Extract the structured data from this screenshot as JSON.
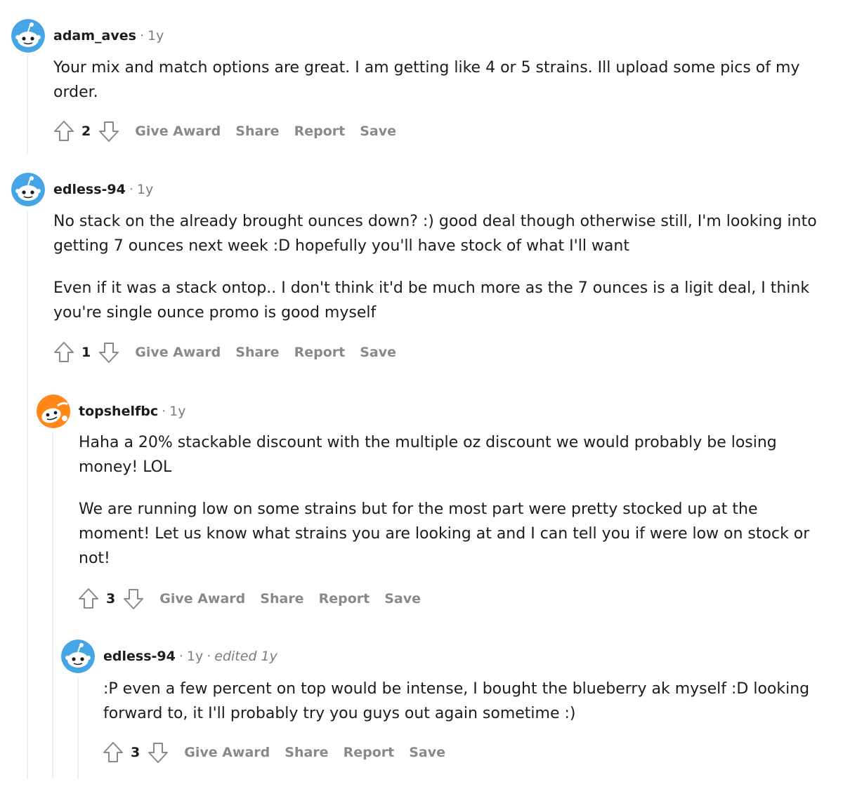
{
  "comments": [
    {
      "author": "adam_aves",
      "time": "1y",
      "edited": "",
      "avatar": "blue-snoo-icon",
      "paragraphs": [
        "Your mix and match options are great. I am getting like 4 or 5 strains. Ill upload some pics of my order."
      ],
      "score": "2",
      "actions": {
        "award": "Give Award",
        "share": "Share",
        "report": "Report",
        "save": "Save"
      }
    },
    {
      "author": "edless-94",
      "time": "1y",
      "edited": "",
      "avatar": "blue-snoo-icon",
      "paragraphs": [
        "No stack on the already brought ounces down? :) good deal though otherwise still, I'm looking into getting 7 ounces next week :D hopefully you'll have stock of what I'll want",
        "Even if it was a stack ontop.. I don't think it'd be much more as the 7 ounces is a ligit deal, I think you're single ounce promo is good myself"
      ],
      "score": "1",
      "actions": {
        "award": "Give Award",
        "share": "Share",
        "report": "Report",
        "save": "Save"
      }
    },
    {
      "author": "topshelfbc",
      "time": "1y",
      "edited": "",
      "avatar": "orange-snoo-icon",
      "paragraphs": [
        "Haha a 20% stackable discount with the multiple oz discount we would probably be losing money! LOL",
        "We are running low on some strains but for the most part were pretty stocked up at the moment! Let us know what strains you are looking at and I can tell you if were low on stock or not!"
      ],
      "score": "3",
      "actions": {
        "award": "Give Award",
        "share": "Share",
        "report": "Report",
        "save": "Save"
      }
    },
    {
      "author": "edless-94",
      "time": "1y",
      "edited": "edited 1y",
      "avatar": "blue-snoo-icon",
      "paragraphs": [
        ":P even a few percent on top would be intense, I bought the blueberry ak myself :D looking forward to, it I'll probably try you guys out again sometime :)"
      ],
      "score": "3",
      "actions": {
        "award": "Give Award",
        "share": "Share",
        "report": "Report",
        "save": "Save"
      }
    }
  ],
  "colors": {
    "blue_avatar": "#46a5e5",
    "orange_avatar": "#ff8717",
    "meta_gray": "#7c7c7c",
    "action_gray": "#878a8c",
    "thread_line": "#edeff1"
  }
}
